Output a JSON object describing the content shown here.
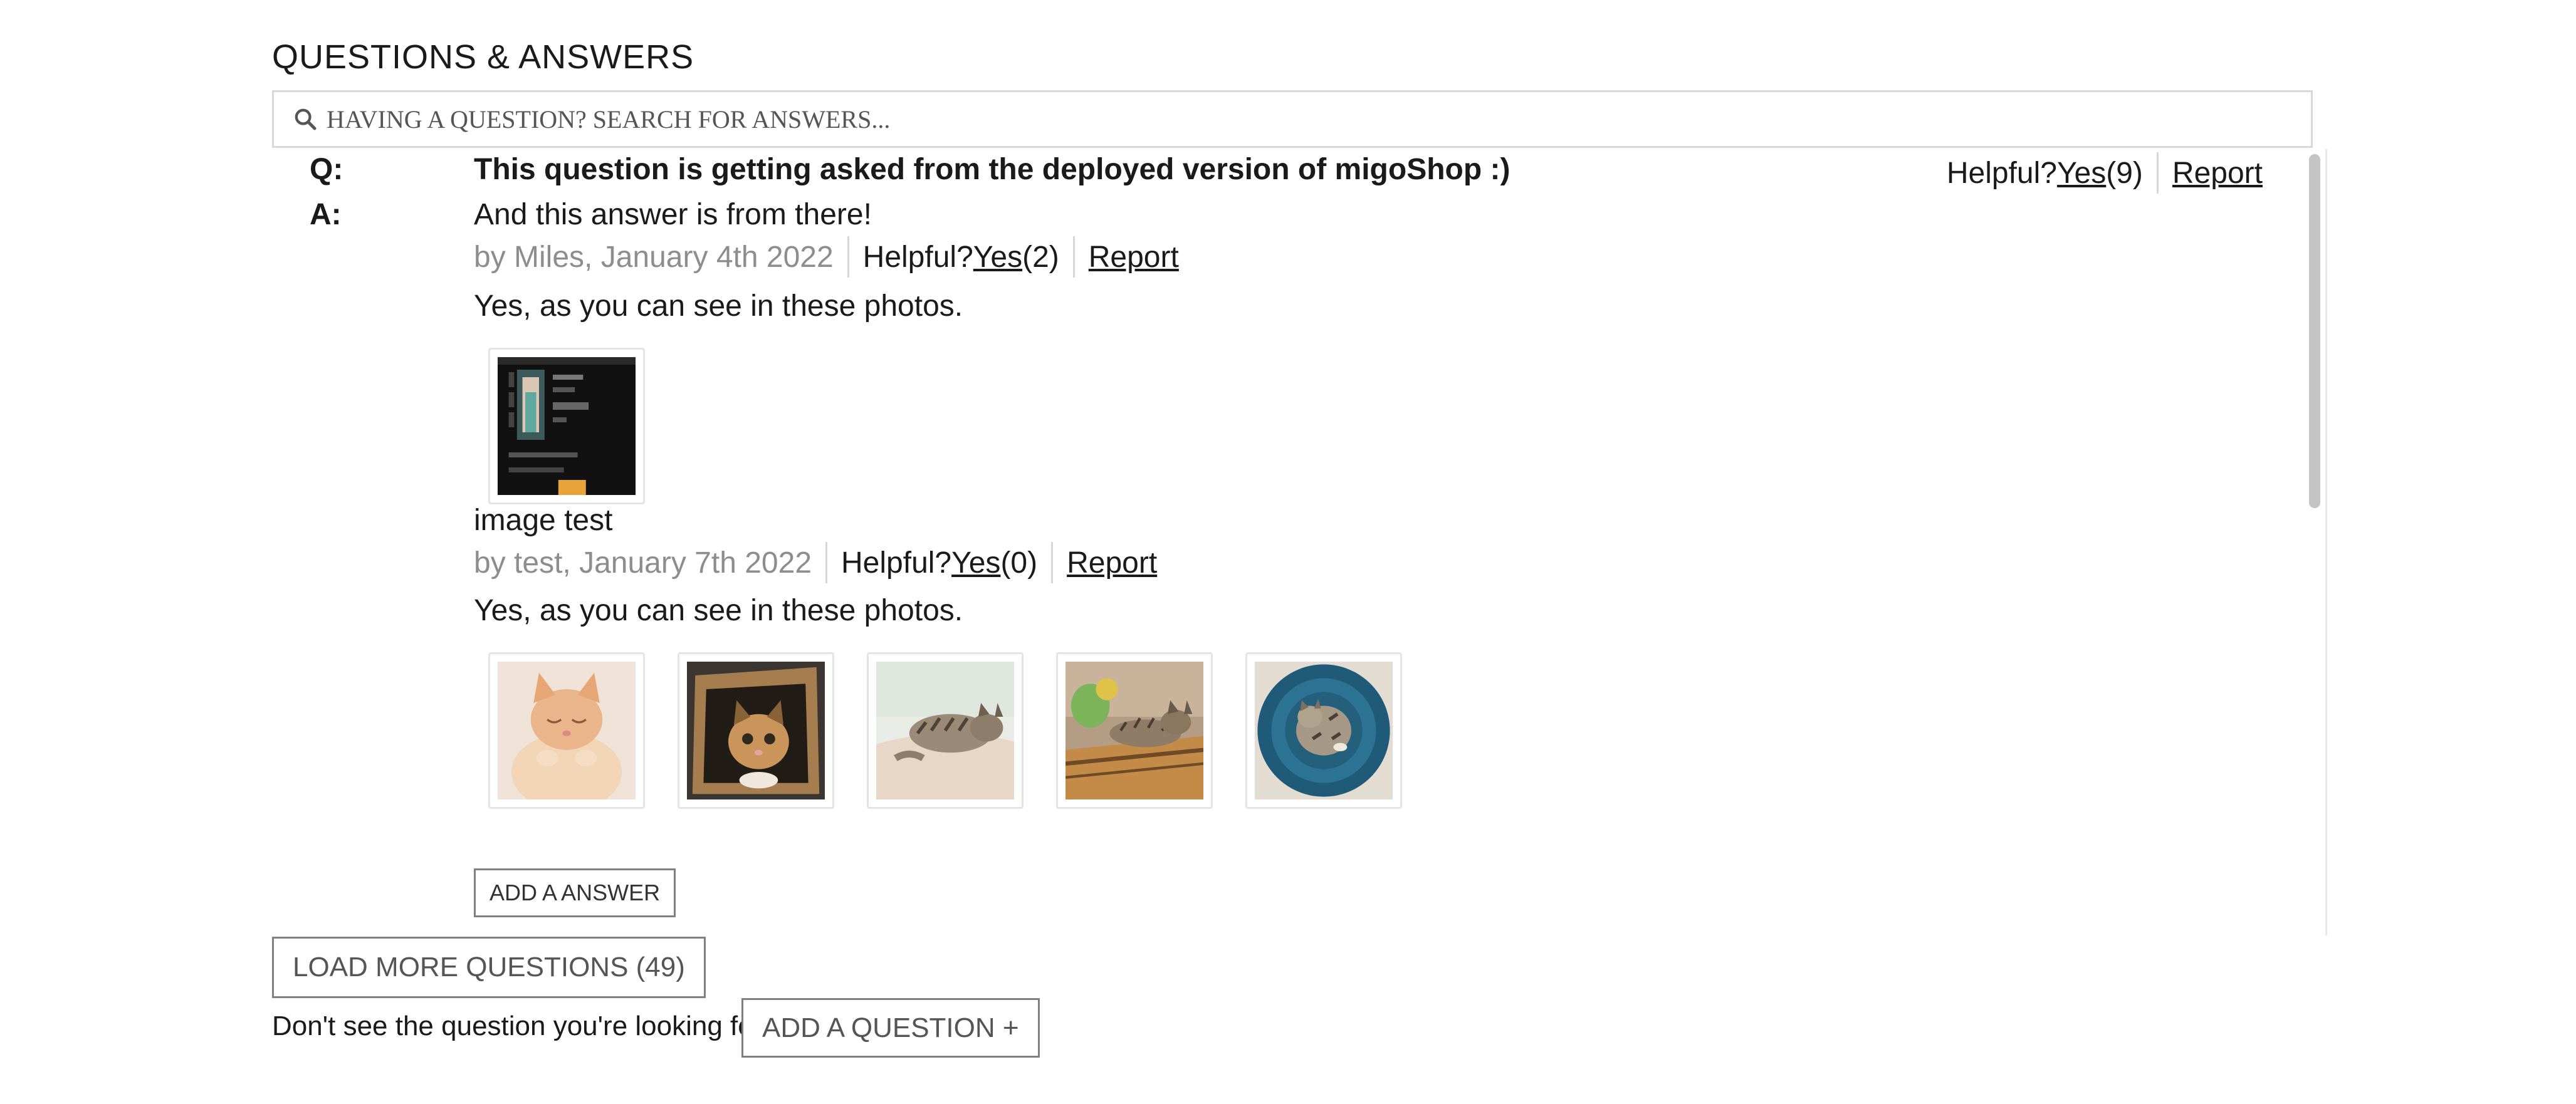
{
  "title": "QUESTIONS & ANSWERS",
  "search": {
    "placeholder": "HAVING A QUESTION? SEARCH FOR ANSWERS..."
  },
  "labels": {
    "q": "Q:",
    "a": "A:"
  },
  "question": {
    "text": "This question is getting asked from the deployed version of migoShop :)",
    "helpful_label": "Helpful?",
    "yes_label": "Yes",
    "helpful_count": "(9)",
    "report_label": "Report"
  },
  "answers": [
    {
      "body": "And this answer is from there!",
      "by": "by Miles, January 4th 2022",
      "helpful_label": "Helpful?",
      "yes_label": "Yes",
      "helpful_count": "(2)",
      "report_label": "Report",
      "photos_caption": "Yes, as you can see in these photos.",
      "photos": [
        "website-screenshot-thumbnail"
      ]
    },
    {
      "body": "image test",
      "by": "by test, January 7th 2022",
      "helpful_label": "Helpful?",
      "yes_label": "Yes",
      "helpful_count": "(0)",
      "report_label": "Report",
      "photos_caption": "Yes, as you can see in these photos.",
      "photos": [
        "sleeping-kitten",
        "kitten-in-box",
        "kitten-on-blanket",
        "kitten-on-couch",
        "kitten-in-blue-bed"
      ]
    }
  ],
  "add_answer_label": "ADD A ANSWER",
  "load_more_label": "LOAD MORE QUESTIONS (49)",
  "dont_see_text": "Don't see the question you're looking for?",
  "add_question_label": "ADD A QUESTION +"
}
